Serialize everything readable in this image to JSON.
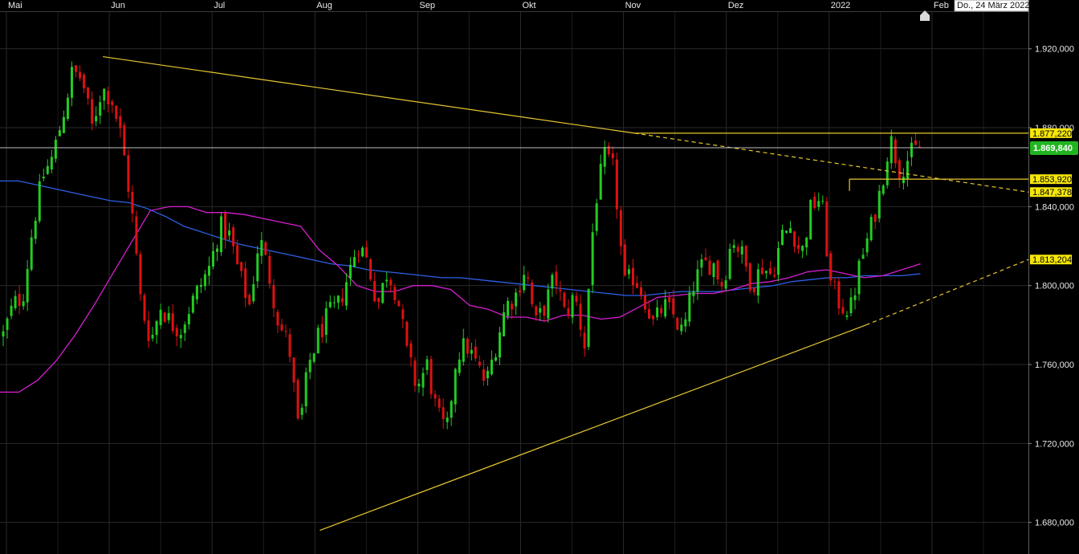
{
  "date_badge": "Do., 24 März 2022",
  "colors": {
    "background": "#000000",
    "grid": "#2a2a2a",
    "up": "#22cc22",
    "down": "#dd1111",
    "trendline": "#e8c830",
    "ma_blue": "#2f5fe6",
    "ma_magenta": "#d61ed0",
    "price_badge": "#22b522",
    "level_badge": "#f5e60a"
  },
  "icons": {
    "top_marker": "house-icon"
  },
  "chart_data": {
    "type": "candlestick",
    "x_months": [
      "Mai",
      "Jun",
      "Jul",
      "Aug",
      "Sep",
      "Okt",
      "Nov",
      "Dez",
      "2022",
      "Feb"
    ],
    "y_ticks": [
      "1.920,000",
      "1.880,000",
      "1.840,000",
      "1.800,000",
      "1.760,000",
      "1.720,000",
      "1.680,000"
    ],
    "y_tick_values": [
      1920,
      1880,
      1840,
      1800,
      1760,
      1720,
      1680
    ],
    "ylim": [
      1664,
      1939
    ],
    "current_price": {
      "label": "1.869,840",
      "value": 1869.84
    },
    "levels": [
      {
        "label": "1.877,220",
        "value": 1877.22
      },
      {
        "label": "1.853,920",
        "value": 1853.92
      },
      {
        "label": "1.847,378",
        "value": 1847.378
      },
      {
        "label": "1.813,204",
        "value": 1813.204
      }
    ],
    "anchor_closes": [
      1775,
      1790,
      1795,
      1830,
      1855,
      1865,
      1885,
      1908,
      1905,
      1880,
      1900,
      1895,
      1875,
      1840,
      1790,
      1772,
      1790,
      1781,
      1778,
      1790,
      1800,
      1810,
      1830,
      1825,
      1805,
      1790,
      1825,
      1805,
      1780,
      1770,
      1725,
      1760,
      1775,
      1785,
      1790,
      1805,
      1822,
      1812,
      1790,
      1808,
      1795,
      1765,
      1748,
      1760,
      1735,
      1725,
      1765,
      1770,
      1760,
      1750,
      1770,
      1790,
      1795,
      1810,
      1780,
      1790,
      1805,
      1785,
      1795,
      1770,
      1840,
      1865,
      1858,
      1800,
      1805,
      1795,
      1780,
      1790,
      1785,
      1775,
      1800,
      1810,
      1812,
      1800,
      1825,
      1815,
      1800,
      1810,
      1805,
      1825,
      1830,
      1815,
      1840,
      1845,
      1800,
      1790,
      1788,
      1812,
      1828,
      1848,
      1875,
      1858,
      1866,
      1870
    ],
    "moving_averages": [
      {
        "color": "ma_blue",
        "values": [
          1853,
          1853,
          1851,
          1849,
          1847,
          1845,
          1843,
          1842,
          1839,
          1835,
          1830,
          1827,
          1824,
          1821,
          1819,
          1817,
          1815,
          1813,
          1811,
          1810,
          1808,
          1807,
          1806,
          1805,
          1804,
          1804,
          1803,
          1802,
          1801,
          1800,
          1799,
          1798,
          1797,
          1796,
          1795,
          1795,
          1796,
          1797,
          1797,
          1797,
          1798,
          1799,
          1800,
          1802,
          1803,
          1804,
          1804,
          1805,
          1805,
          1805,
          1806
        ]
      },
      {
        "color": "ma_magenta",
        "values": [
          1746,
          1746,
          1752,
          1762,
          1775,
          1790,
          1806,
          1822,
          1838,
          1840,
          1840,
          1837,
          1837,
          1836,
          1834,
          1832,
          1830,
          1818,
          1810,
          1800,
          1797,
          1797,
          1800,
          1800,
          1798,
          1790,
          1788,
          1784,
          1784,
          1782,
          1785,
          1785,
          1783,
          1784,
          1789,
          1794,
          1795,
          1796,
          1796,
          1798,
          1801,
          1802,
          1804,
          1807,
          1808,
          1806,
          1804,
          1805,
          1808,
          1811
        ]
      }
    ]
  }
}
